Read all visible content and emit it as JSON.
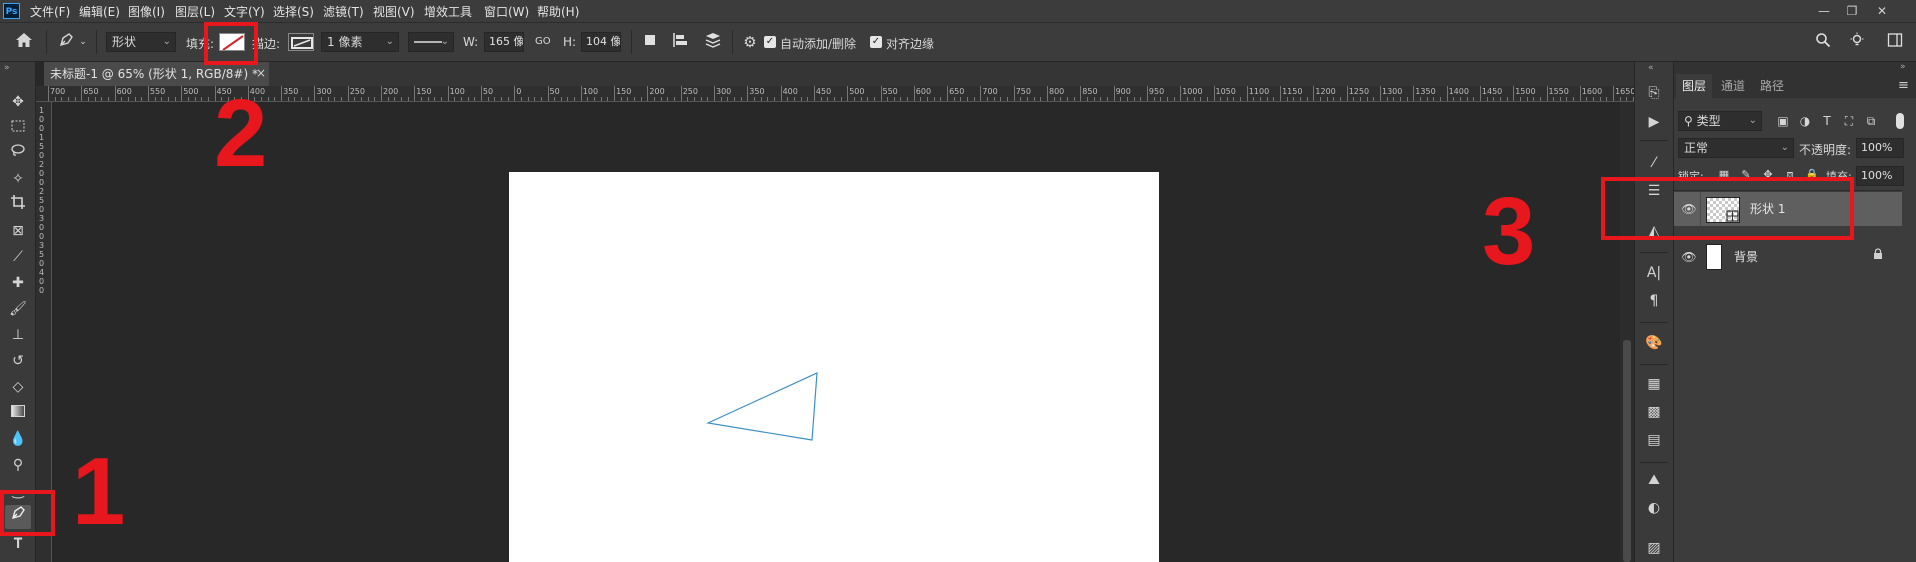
{
  "app": {
    "logo": "Ps"
  },
  "menu": [
    "文件(F)",
    "编辑(E)",
    "图像(I)",
    "图层(L)",
    "文字(Y)",
    "选择(S)",
    "滤镜(T)",
    "视图(V)",
    "增效工具",
    "窗口(W)",
    "帮助(H)"
  ],
  "window_controls": {
    "minimize": "—",
    "restore": "❐",
    "close": "✕"
  },
  "options": {
    "mode_select": "形状",
    "fill_label": "填充:",
    "stroke_label": "描边:",
    "stroke_width": "1 像素",
    "w_label": "W:",
    "w_value": "165 像",
    "link_label": "GO",
    "h_label": "H:",
    "h_value": "104 像",
    "auto_add_delete": "自动添加/删除",
    "align_edges": "对齐边缘",
    "colors": {
      "stroke_swatch_color": "#4a90c2",
      "fill_none_slash": "#d2262b"
    }
  },
  "document_tab": {
    "title": "未标题-1 @ 65% (形状 1, RGB/8#) *",
    "close": "×"
  },
  "ruler": {
    "top_labels": [
      "700",
      "650",
      "600",
      "550",
      "500",
      "450",
      "400",
      "350",
      "300",
      "250",
      "200",
      "150",
      "100",
      "50",
      "0",
      "50",
      "100",
      "150",
      "200",
      "250",
      "300",
      "350",
      "400",
      "450",
      "500",
      "550",
      "600",
      "650",
      "700",
      "750",
      "800",
      "850",
      "900",
      "950",
      "1000",
      "1050",
      "1100",
      "1150",
      "1200",
      "1250",
      "1300",
      "1350",
      "1400",
      "1450",
      "1500",
      "1550",
      "1600",
      "1650"
    ],
    "left_labels": [
      "1",
      "0",
      "0",
      "1",
      "5",
      "0",
      "2",
      "0",
      "0",
      "2",
      "5",
      "0",
      "3",
      "0",
      "0",
      "3",
      "5",
      "0",
      "4",
      "0",
      "0"
    ]
  },
  "canvas": {
    "shape_color": "#3d8fc6"
  },
  "layers_panel": {
    "tabs": [
      "图层",
      "通道",
      "路径"
    ],
    "filter_select": "类型",
    "blend_mode": "正常",
    "opacity_label": "不透明度:",
    "opacity_value": "100%",
    "lock_label": "锁定:",
    "fill_label": "填充:",
    "fill_value": "100%",
    "layers": [
      {
        "name": "形状 1",
        "selected": true
      },
      {
        "name": "背景",
        "selected": false,
        "locked": true
      }
    ]
  },
  "annotations": {
    "one": "1",
    "two": "2",
    "three": "3",
    "color": "#e8161d"
  },
  "icons": [
    "home-icon",
    "pen-tool-icon",
    "chain-link-icon",
    "gear-icon",
    "search-icon",
    "lightbulb-icon",
    "panel-icon",
    "eye-icon",
    "lock-icon"
  ]
}
